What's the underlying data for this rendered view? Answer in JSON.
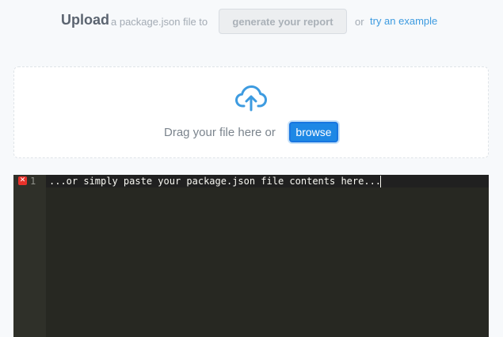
{
  "header": {
    "title": "Upload",
    "subtitle": "a package.json file to",
    "generate_button": "generate your report",
    "or_text": "or",
    "example_link": "try an example"
  },
  "dropzone": {
    "icon": "cloud-upload-icon",
    "drag_text": "Drag your file here or",
    "browse_button": "browse"
  },
  "editor": {
    "line_number": "1",
    "error_marker": "✕",
    "placeholder": "...or simply paste your package.json file contents here..."
  },
  "colors": {
    "accent": "#1e88e5",
    "link": "#3d9be0",
    "editor_bg": "#272822",
    "error": "#e8312a"
  }
}
